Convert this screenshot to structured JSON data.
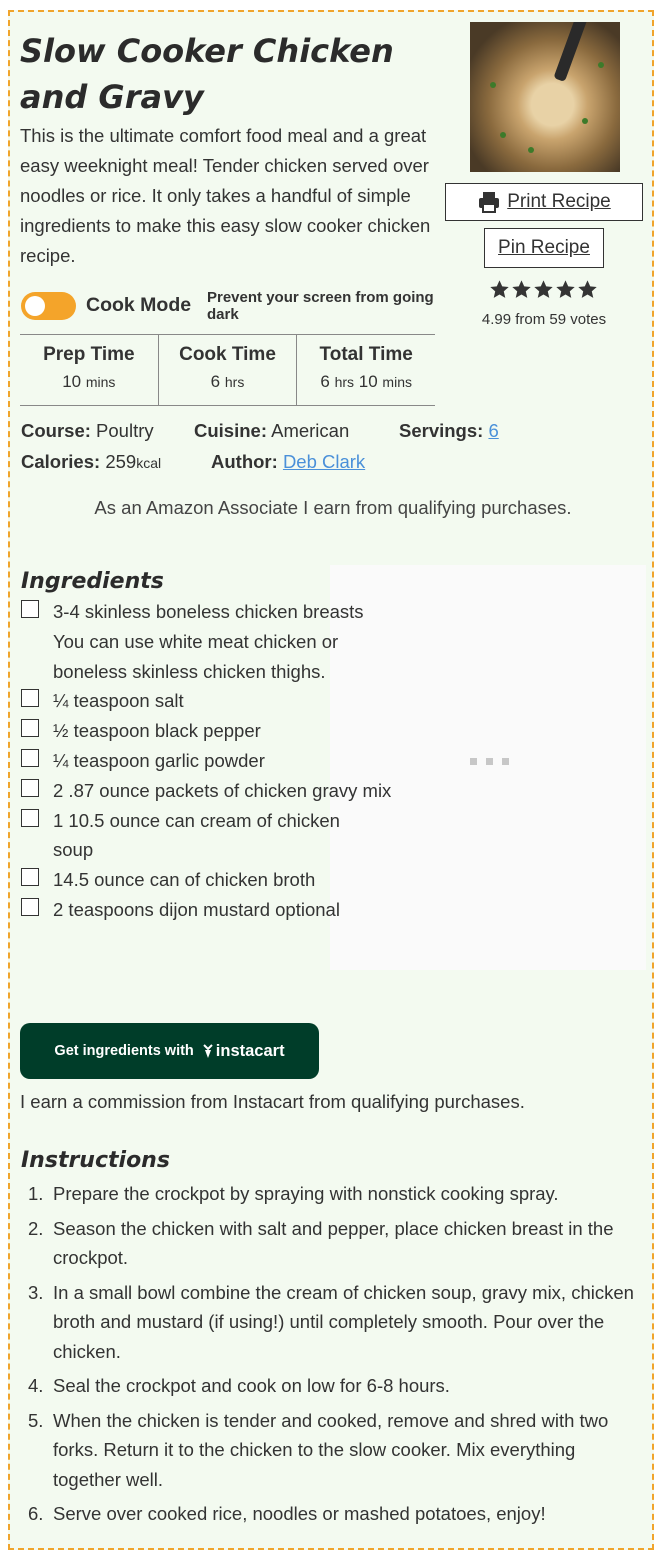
{
  "recipe": {
    "title": "Slow Cooker Chicken and Gravy",
    "summary": "This is the ultimate comfort food meal and a great easy weeknight meal! Tender chicken served over noodles or rice. It only takes a handful of simple ingredients to make this easy slow cooker chicken recipe.",
    "print_label": "Print Recipe",
    "pin_label": "Pin Recipe",
    "rating": {
      "stars": 5,
      "value": 4.99,
      "votes_text": "4.99 from 59 votes"
    },
    "cook_mode": {
      "label": "Cook Mode",
      "description": "Prevent your screen from going dark",
      "enabled": true,
      "accent_color": "#f4a42a"
    },
    "times": [
      {
        "label": "Prep Time",
        "parts": [
          {
            "num": "10",
            "unit": "mins"
          }
        ]
      },
      {
        "label": "Cook Time",
        "parts": [
          {
            "num": "6",
            "unit": "hrs"
          }
        ]
      },
      {
        "label": "Total Time",
        "parts": [
          {
            "num": "6",
            "unit": "hrs"
          },
          {
            "num": "10",
            "unit": "mins"
          }
        ]
      }
    ],
    "meta": {
      "course_label": "Course:",
      "course": "Poultry",
      "cuisine_label": "Cuisine:",
      "cuisine": "American",
      "servings_label": "Servings:",
      "servings": "6",
      "calories_label": "Calories:",
      "calories": "259",
      "calories_unit": "kcal",
      "author_label": "Author:",
      "author": "Deb Clark"
    },
    "disclaimer": "As an Amazon Associate I earn from qualifying purchases.",
    "ingredients_heading": "Ingredients",
    "ingredients": [
      "3-4 skinless boneless chicken breasts You can use white meat chicken or boneless skinless chicken thighs.",
      "¼ teaspoon salt",
      "½ teaspoon black pepper",
      "¼ teaspoon garlic powder",
      "2 .87 ounce packets of chicken gravy mix",
      "1 10.5 ounce can cream of chicken soup",
      "14.5 ounce can of chicken broth",
      "2 teaspoons dijon mustard optional"
    ],
    "instacart": {
      "text": "Get ingredients with",
      "brand": "instacart",
      "color": "#003d29"
    },
    "commission": "I earn a commission from Instacart from qualifying purchases.",
    "instructions_heading": "Instructions",
    "instructions": [
      "Prepare the crockpot by spraying with nonstick cooking spray.",
      "Season the chicken with salt and pepper, place chicken breast in the crockpot.",
      "In a small bowl combine the cream of chicken soup, gravy mix, chicken broth and mustard (if using!) until completely smooth. Pour over the chicken.",
      "Seal the crockpot and cook on low for 6-8 hours.",
      "When the chicken is tender and cooked, remove and shred with two forks. Return it to the chicken to the slow cooker. Mix everything together well.",
      "Serve over cooked rice, noodles or mashed potatoes, enjoy!"
    ],
    "border_color": "#f0a42c",
    "card_bg": "#f3faf0"
  }
}
